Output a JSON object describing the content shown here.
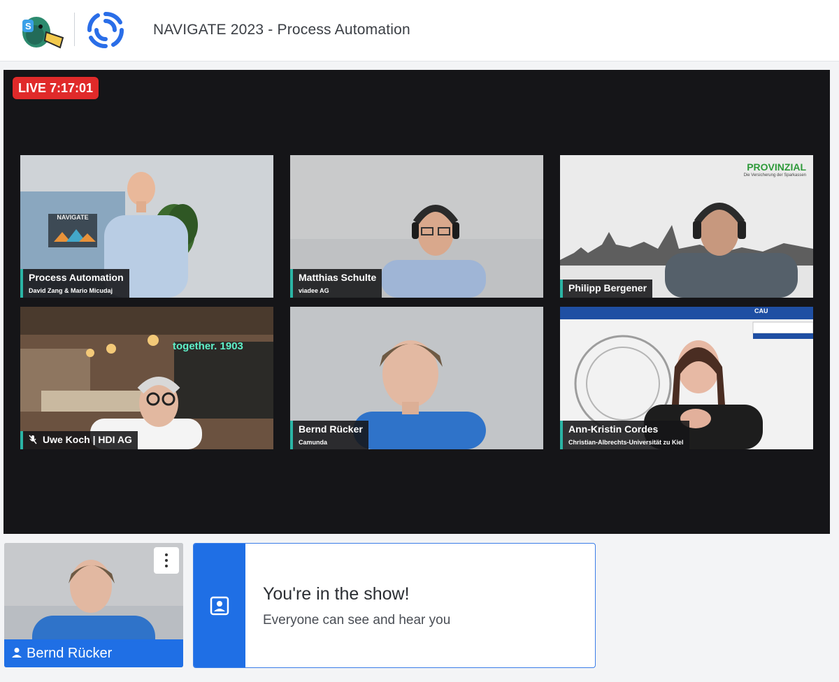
{
  "header": {
    "title": "NAVIGATE 2023 - Process Automation",
    "logos": [
      "streamyard-duck-logo",
      "camunda-swirl-logo"
    ]
  },
  "stage": {
    "live_badge": "LIVE 7:17:01",
    "tiles": [
      {
        "name": "Process Automation",
        "subtitle": "David Zang & Mario Micudaj"
      },
      {
        "name": "Matthias Schulte",
        "subtitle": "viadee AG"
      },
      {
        "name": "Philipp Bergener",
        "subtitle": ""
      },
      {
        "name": "Uwe Koch | HDI AG",
        "subtitle": "",
        "muted": true
      },
      {
        "name": "Bernd Rücker",
        "subtitle": "Camunda"
      },
      {
        "name": "Ann-Kristin Cordes",
        "subtitle": "Christian-Albrechts-Universität zu Kiel"
      }
    ],
    "backgrounds": {
      "navigate_sign": "NAVIGATE",
      "provinzial": "PROVINZIAL",
      "provinzial_tag": "Die Versicherung der Sparkassen",
      "neon": "together. 1903",
      "cau": "CAU"
    }
  },
  "self_view": {
    "name": "Bernd Rücker"
  },
  "status_card": {
    "title": "You're in the show!",
    "subtitle": "Everyone can see and hear you"
  },
  "colors": {
    "accent_blue": "#1f6fe5",
    "live_red": "#e02a2a",
    "nameplate_bar": "#2bb5a5",
    "stage_bg": "#151518"
  }
}
